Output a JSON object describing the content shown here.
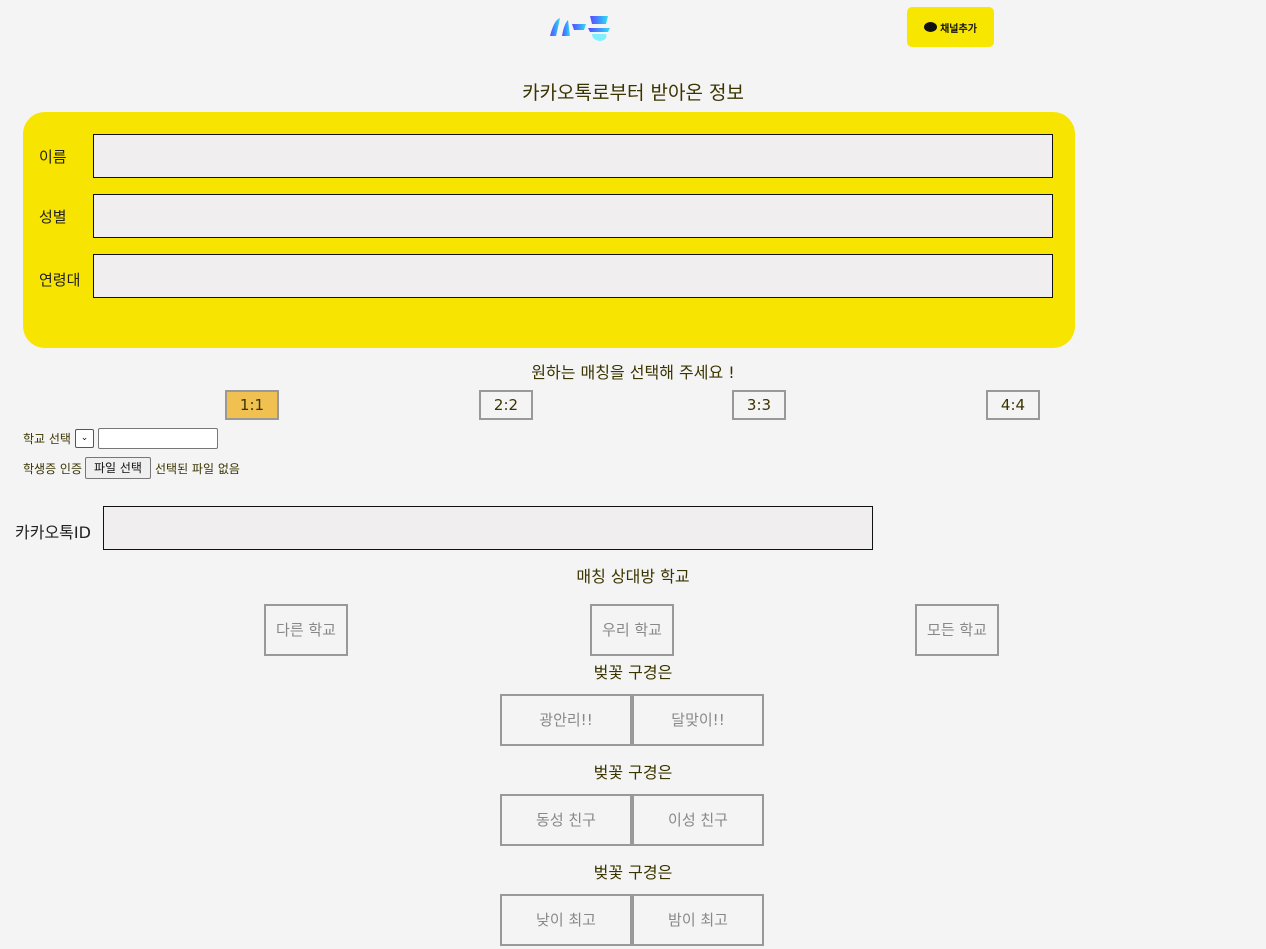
{
  "header": {
    "logo_alt": "새봄",
    "channel_button": "채널추가"
  },
  "page_title": "카카오톡로부터 받아온 정보",
  "info": {
    "name_label": "이름",
    "gender_label": "성별",
    "age_label": "연령대",
    "name_value": "",
    "gender_value": "",
    "age_value": ""
  },
  "matching": {
    "prompt": "원하는 매칭을 선택해 주세요 !",
    "options": [
      "1:1",
      "2:2",
      "3:3",
      "4:4"
    ],
    "selected": "1:1"
  },
  "school": {
    "select_label": "학교 선택",
    "select_value": "",
    "input_value": "",
    "verify_label": "학생증 인증",
    "file_button": "파일 선택",
    "file_status": "선택된 파일 없음"
  },
  "kakao": {
    "id_label": "카카오톡ID",
    "id_value": ""
  },
  "partner_school": {
    "title": "매칭 상대방 학교",
    "options": [
      "다른 학교",
      "우리 학교",
      "모든 학교"
    ]
  },
  "question1": {
    "title": "벚꽃 구경은",
    "options": [
      "광안리!!",
      "달맞이!!"
    ]
  },
  "question2": {
    "title": "벚꽃 구경은",
    "options": [
      "동성 친구",
      "이성 친구"
    ]
  },
  "question3": {
    "title": "벚꽃 구경은",
    "options": [
      "낮이 최고",
      "밤이 최고"
    ]
  },
  "colors": {
    "kakao_yellow": "#f7e400",
    "selected_option": "#f0c050",
    "background": "#f4f4f4"
  }
}
